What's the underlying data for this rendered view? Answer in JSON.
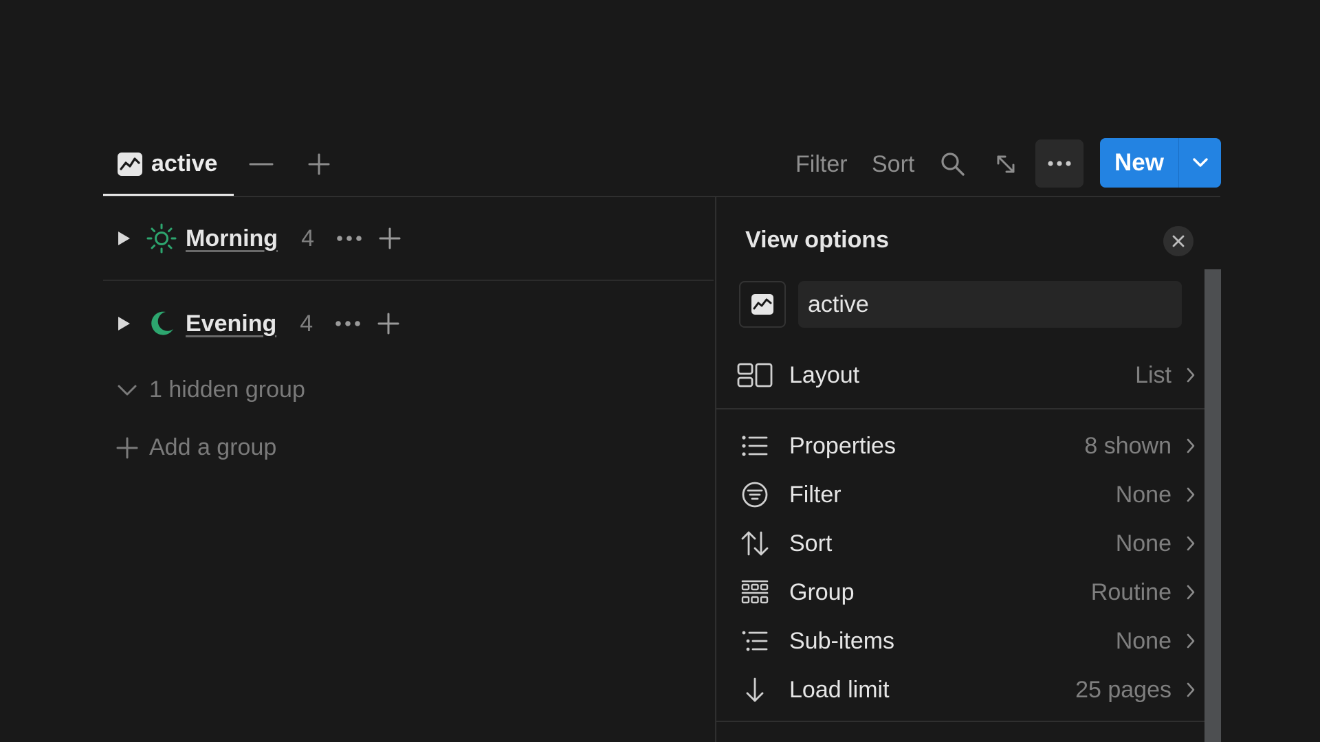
{
  "toolbar": {
    "view_tab_label": "active",
    "filter_label": "Filter",
    "sort_label": "Sort",
    "new_label": "New"
  },
  "groups": [
    {
      "name": "Morning",
      "count": "4",
      "icon": "sun-icon",
      "icon_color": "#2da66f"
    },
    {
      "name": "Evening",
      "count": "4",
      "icon": "moon-icon",
      "icon_color": "#2da66f"
    }
  ],
  "hidden_groups_label": "1 hidden group",
  "add_group_label": "Add a group",
  "view_options": {
    "title": "View options",
    "view_name": "active",
    "layout": {
      "label": "Layout",
      "value": "List"
    },
    "items": [
      {
        "label": "Properties",
        "value": "8 shown",
        "icon": "list-icon"
      },
      {
        "label": "Filter",
        "value": "None",
        "icon": "filter-circle-icon"
      },
      {
        "label": "Sort",
        "value": "None",
        "icon": "sort-arrows-icon"
      },
      {
        "label": "Group",
        "value": "Routine",
        "icon": "group-grid-icon"
      },
      {
        "label": "Sub-items",
        "value": "None",
        "icon": "sub-items-icon"
      },
      {
        "label": "Load limit",
        "value": "25 pages",
        "icon": "arrow-down-icon"
      }
    ]
  },
  "colors": {
    "accent": "#2383e2",
    "background": "#191919",
    "group_icon": "#2da66f"
  }
}
